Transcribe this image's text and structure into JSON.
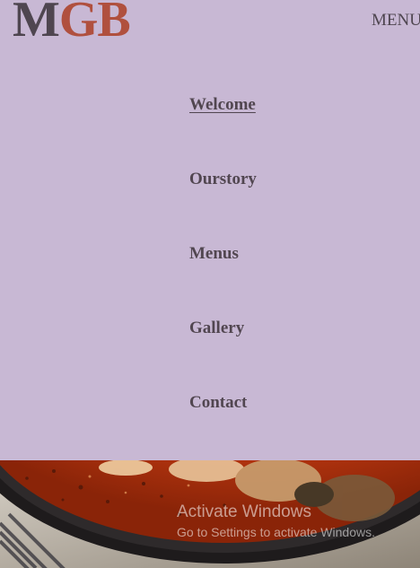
{
  "header": {
    "logo_m": "M",
    "logo_gb": "GB",
    "menu_label": "MENU"
  },
  "nav": {
    "items": [
      {
        "label": "Welcome",
        "active": true
      },
      {
        "label": "Ourstory"
      },
      {
        "label": "Menus"
      },
      {
        "label": "Gallery"
      },
      {
        "label": "Contact"
      }
    ]
  },
  "watermark": {
    "title": "Activate Windows",
    "subtitle": "Go to Settings to activate Windows."
  },
  "colors": {
    "background": "#c8b8d4",
    "logo_dark": "#4f4650",
    "logo_accent": "#b0503e",
    "nav_text": "#514650"
  }
}
